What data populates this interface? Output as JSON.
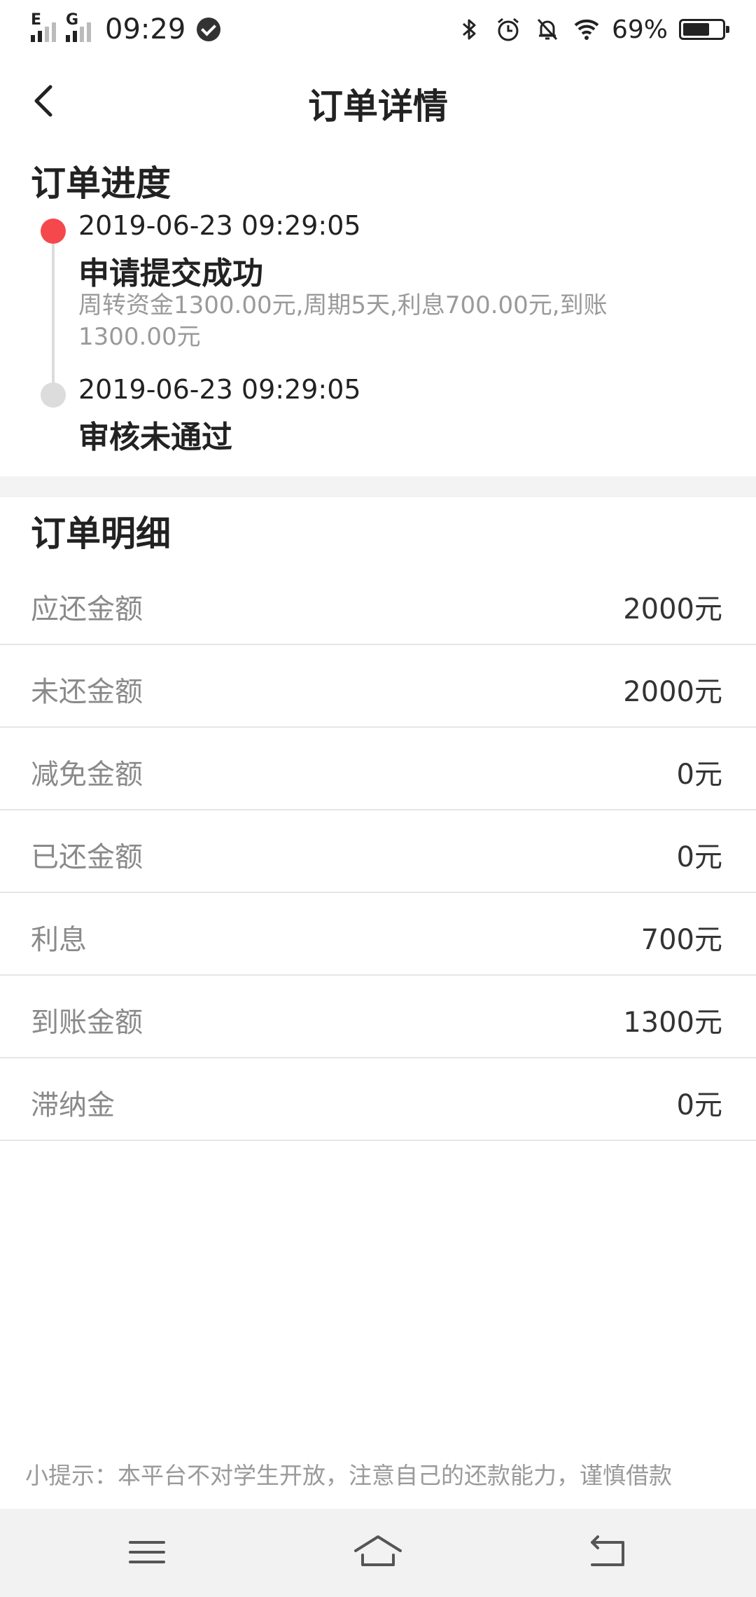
{
  "status_bar": {
    "signal1_label": "E",
    "signal2_label": "G",
    "time": "09:29",
    "battery_text": "69%",
    "battery_level_pct": 69
  },
  "nav": {
    "title": "订单详情",
    "back_icon": "chevron-left-icon"
  },
  "progress": {
    "title": "订单进度",
    "items": [
      {
        "time": "2019-06-23 09:29:05",
        "status": "申请提交成功",
        "desc": "周转资金1300.00元,周期5天,利息700.00元,到账1300.00元",
        "dot_color": "#f5484d"
      },
      {
        "time": "2019-06-23 09:29:05",
        "status": "审核未通过",
        "desc": "",
        "dot_color": "#dcdcdc"
      }
    ]
  },
  "details": {
    "title": "订单明细",
    "rows": [
      {
        "label": "应还金额",
        "value": "2000元"
      },
      {
        "label": "未还金额",
        "value": "2000元"
      },
      {
        "label": "减免金额",
        "value": "0元"
      },
      {
        "label": "已还金额",
        "value": "0元"
      },
      {
        "label": "利息",
        "value": "700元"
      },
      {
        "label": "到账金额",
        "value": "1300元"
      },
      {
        "label": "滞纳金",
        "value": "0元"
      }
    ]
  },
  "tip": "小提示：本平台不对学生开放，注意自己的还款能力，谨慎借款",
  "system_nav": {
    "menu_icon": "menu-icon",
    "home_icon": "home-icon",
    "back_icon": "back-arrow-icon"
  },
  "colors": {
    "accent_red": "#f5484d",
    "muted_gray": "#9a9a9a",
    "band_gray": "#f3f3f3"
  }
}
